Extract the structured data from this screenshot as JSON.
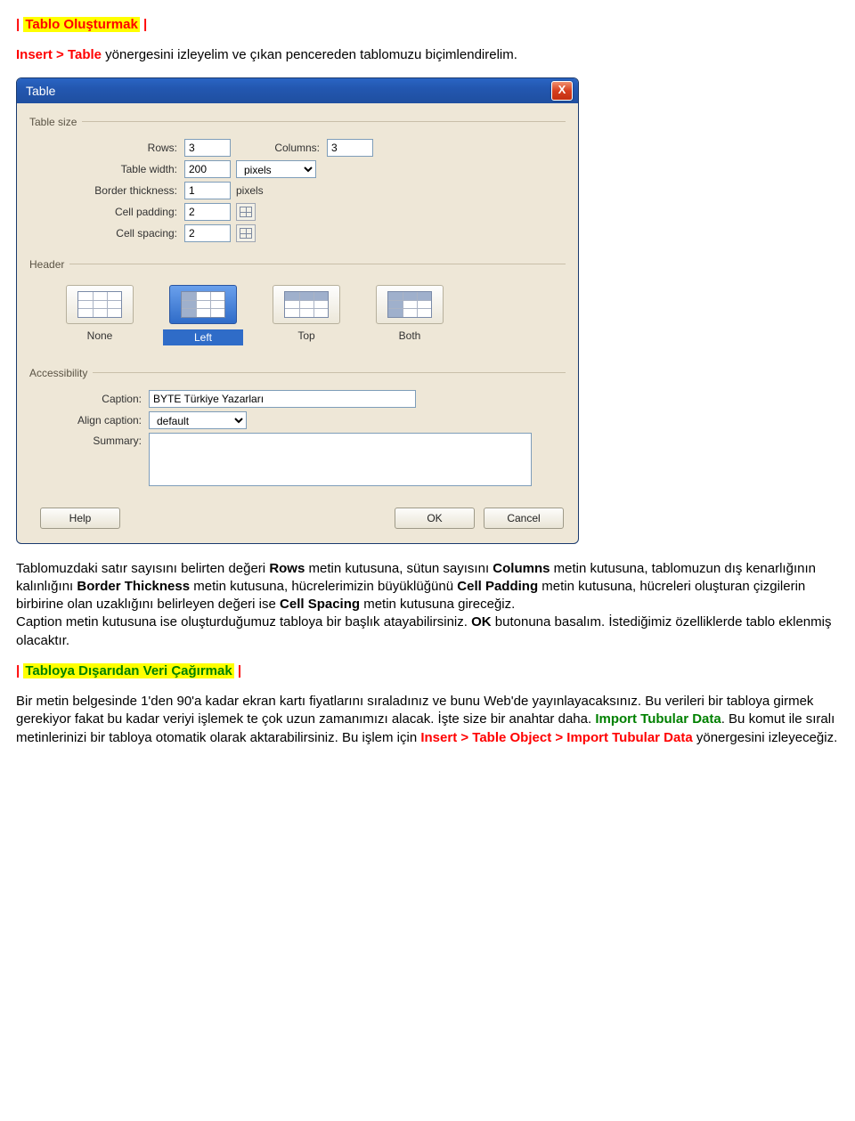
{
  "doc": {
    "section1_title": "Tablo Oluşturmak",
    "intro_prefix": "Insert > Table",
    "intro_rest": " yönergesini izleyelim ve çıkan pencereden tablomuzu biçimlendirelim.",
    "para2_a": "Tablomuzdaki satır sayısını belirten değeri ",
    "para2_rows": "Rows",
    "para2_b": " metin kutusuna, sütun sayısını ",
    "para2_cols": "Columns",
    "para2_c": " metin kutusuna, tablomuzun dış kenarlığının kalınlığını ",
    "para2_bt": "Border Thickness",
    "para2_d": " metin kutusuna, hücrelerimizin büyüklüğünü ",
    "para2_cp": "Cell Padding",
    "para2_e": " metin kutusuna, hücreleri oluşturan çizgilerin birbirine olan uzaklığını belirleyen değeri ise ",
    "para2_cs": "Cell Spacing",
    "para2_f": " metin kutusuna gireceğiz.",
    "para3_a": "Caption metin kutusuna ise oluşturduğumuz tabloya bir başlık atayabilirsiniz. ",
    "para3_ok": "OK",
    "para3_b": " butonuna basalım. İstediğimiz özelliklerde tablo eklenmiş olacaktır.",
    "section2_title": "Tabloya Dışarıdan Veri Çağırmak",
    "para4_a": "Bir metin belgesinde 1'den 90'a kadar ekran kartı fiyatlarını sıraladınız ve bunu Web'de yayınlayacaksınız. Bu verileri bir tabloya girmek gerekiyor fakat bu kadar veriyi işlemek te çok uzun zamanımızı alacak. İşte size bir anahtar daha. ",
    "para4_imp": " Import Tubular Data",
    "para4_b": ". Bu komut ile sıralı metinlerinizi bir tabloya otomatik olarak aktarabilirsiniz. Bu işlem için ",
    "para4_path": "Insert > Table Object > Import Tubular Data",
    "para4_c": " yönergesini izleyeceğiz."
  },
  "dlg": {
    "title": "Table",
    "close": "X",
    "group_size": "Table size",
    "group_header": "Header",
    "group_access": "Accessibility",
    "lbl_rows": "Rows:",
    "val_rows": "3",
    "lbl_cols": "Columns:",
    "val_cols": "3",
    "lbl_width": "Table width:",
    "val_width": "200",
    "width_unit": "pixels",
    "lbl_bt": "Border thickness:",
    "val_bt": "1",
    "bt_unit": "pixels",
    "lbl_cp": "Cell padding:",
    "val_cp": "2",
    "lbl_cs": "Cell spacing:",
    "val_cs": "2",
    "hdr_options": [
      {
        "label": "None"
      },
      {
        "label": "Left"
      },
      {
        "label": "Top"
      },
      {
        "label": "Both"
      }
    ],
    "lbl_caption": "Caption:",
    "val_caption": "BYTE Türkiye Yazarları",
    "lbl_align": "Align caption:",
    "val_align": "default",
    "lbl_summary": "Summary:",
    "val_summary": "",
    "btn_help": "Help",
    "btn_ok": "OK",
    "btn_cancel": "Cancel"
  }
}
